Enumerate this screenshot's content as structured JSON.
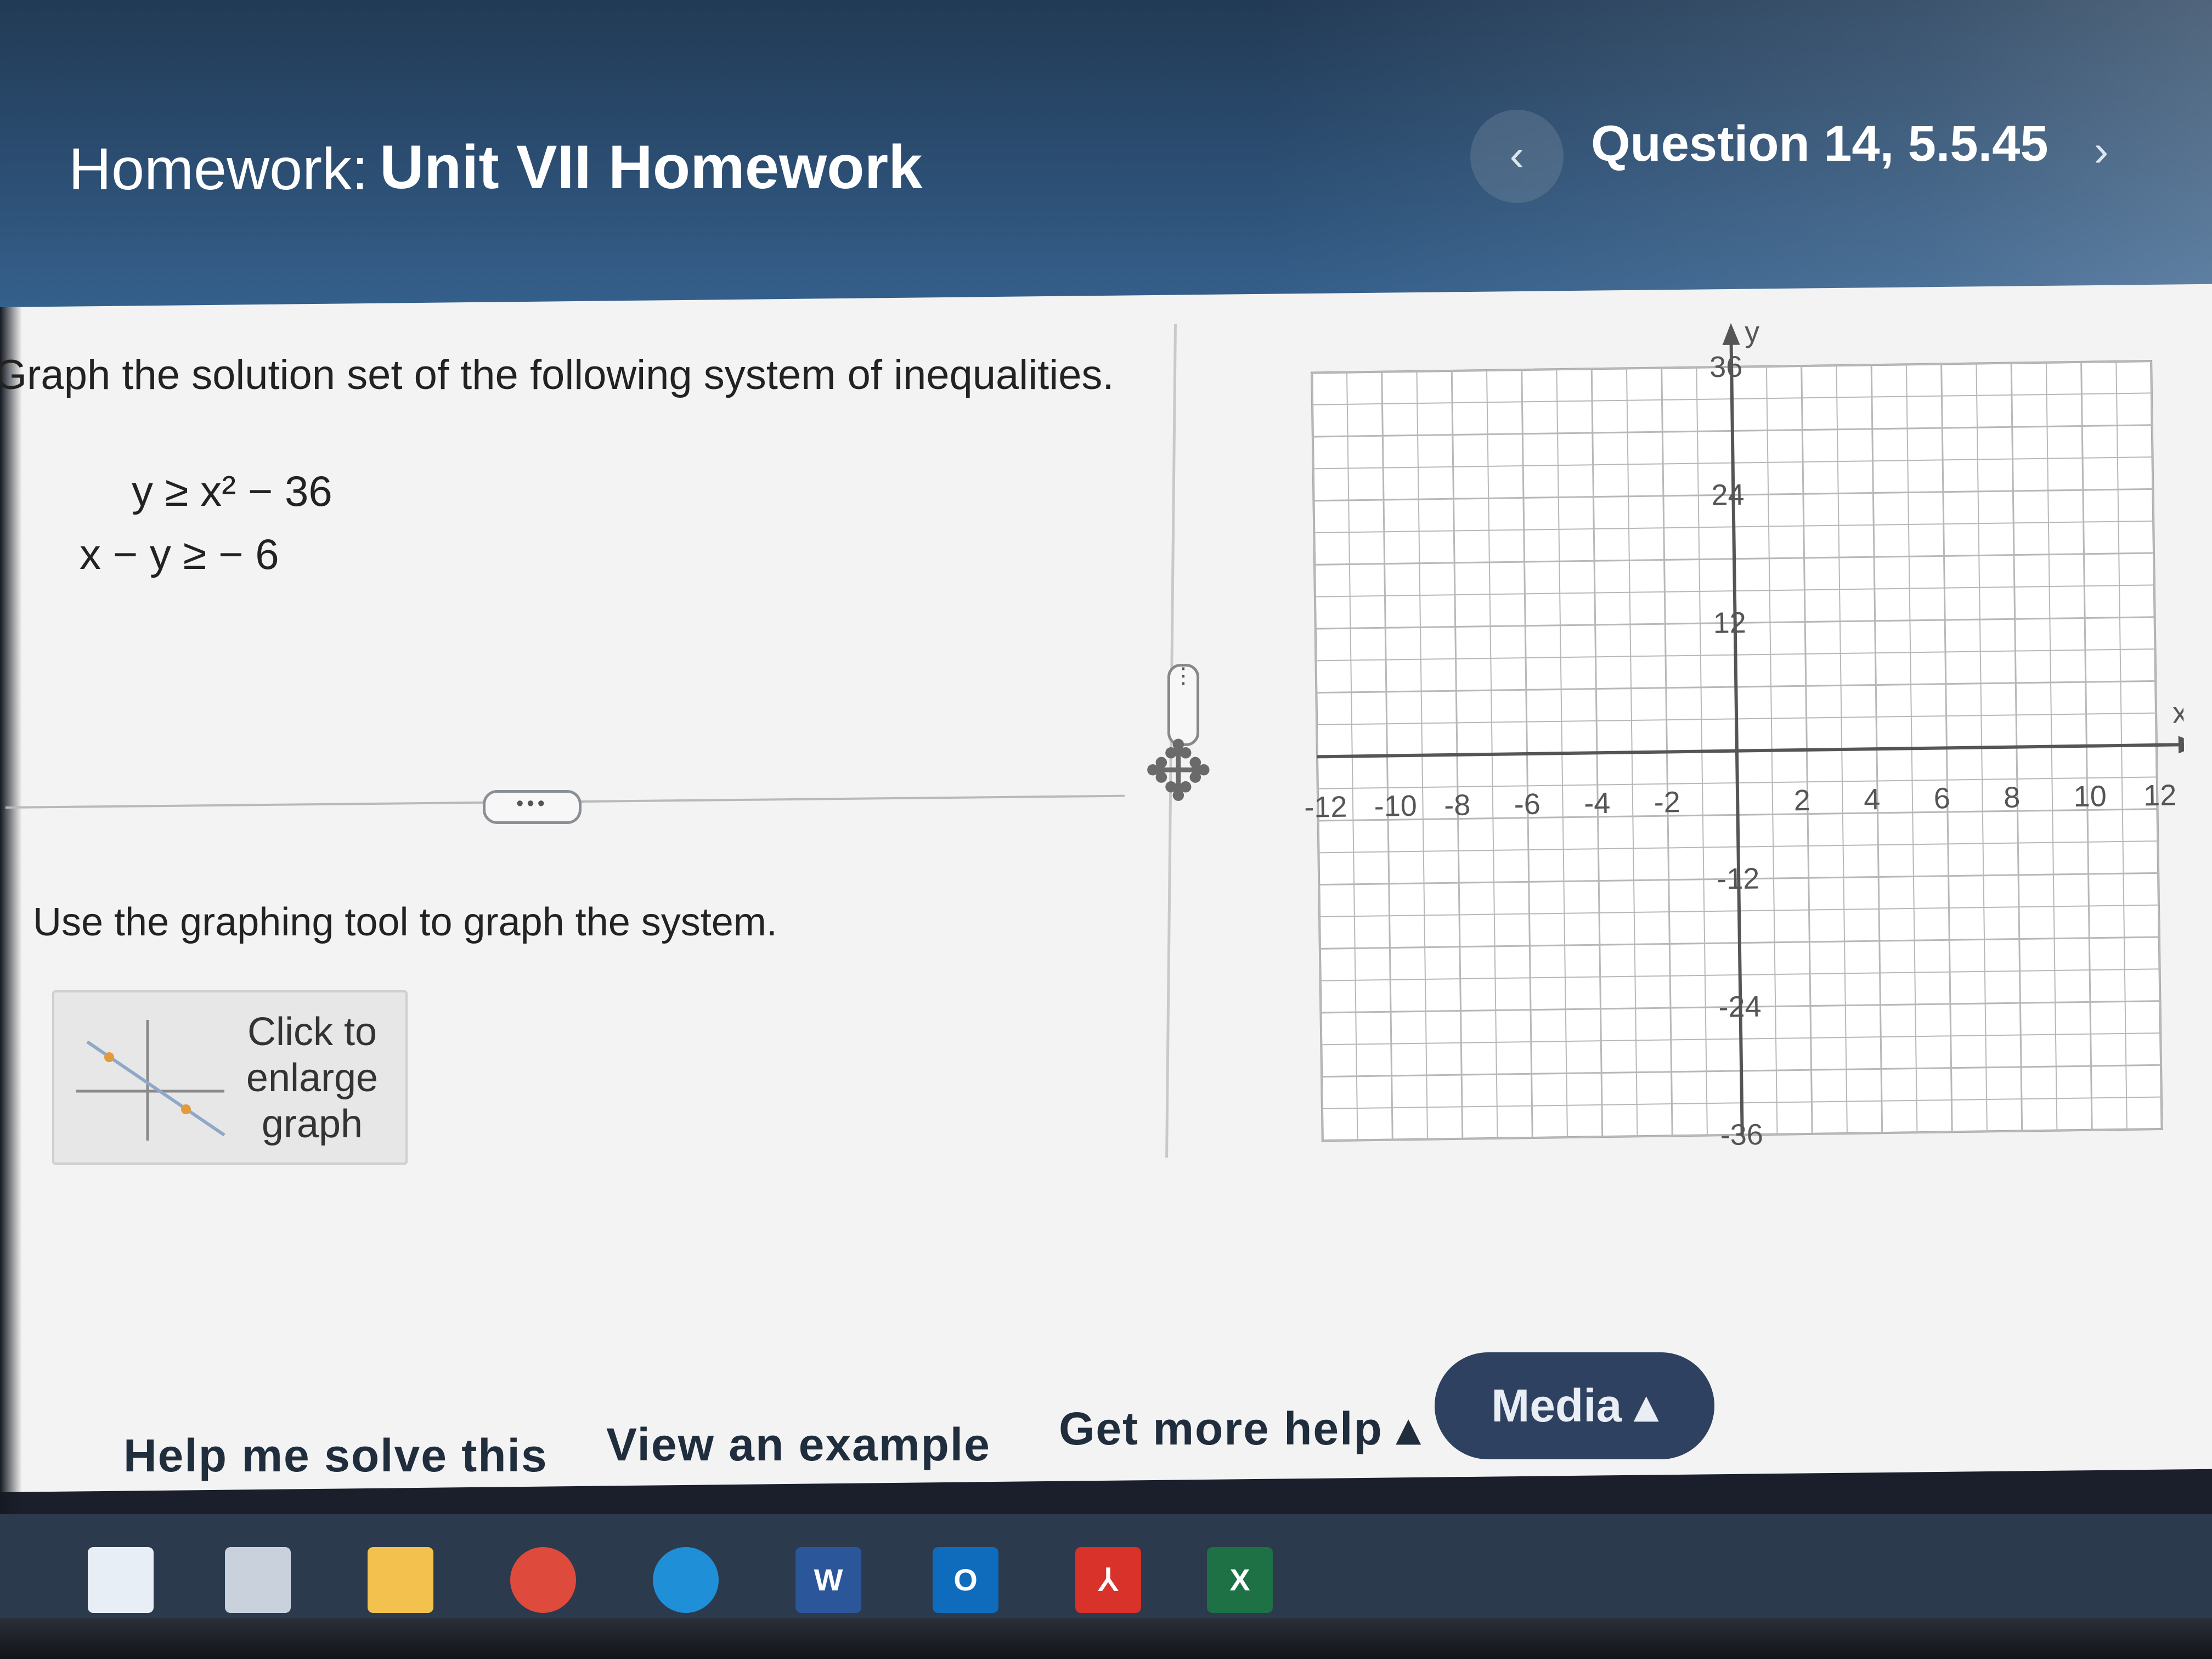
{
  "header": {
    "homework_label": "Homework:",
    "homework_title": "Unit VII Homework",
    "question_label": "Question 14, 5.5.45",
    "prev_symbol": "‹",
    "next_symbol": "›"
  },
  "problem": {
    "instruction": "Graph the solution set of the following system of inequalities.",
    "inequality_1": "y ≥ x² − 36",
    "inequality_2": "x − y ≥  − 6",
    "expand_label": "•••",
    "tool_instruction": "Use the graphing tool to graph the system.",
    "enlarge_label": "Click to\nenlarge\ngraph"
  },
  "graph": {
    "x_axis_label": "x",
    "y_axis_label": "y",
    "x_ticks": [
      "-12",
      "-10",
      "-8",
      "-6",
      "-4",
      "-2",
      "2",
      "4",
      "6",
      "8",
      "10",
      "12"
    ],
    "y_ticks": [
      "36",
      "24",
      "12",
      "-12",
      "-24",
      "-36"
    ],
    "x_range": [
      -12,
      12
    ],
    "y_range": [
      -36,
      36
    ]
  },
  "help": {
    "solve_label": "Help me solve this",
    "example_label": "View an example",
    "more_label": "Get more help ▴",
    "media_label": "Media ▴"
  },
  "taskbar": {
    "icons": [
      {
        "name": "windows-start-icon",
        "label": "",
        "color": "#e8eef5"
      },
      {
        "name": "task-view-icon",
        "label": "",
        "color": "#c9d2dc"
      },
      {
        "name": "file-explorer-icon",
        "label": "",
        "color": "#f2c14e"
      },
      {
        "name": "chrome-icon",
        "label": "",
        "color": "#de4b3c"
      },
      {
        "name": "edge-icon",
        "label": "",
        "color": "#1f8fd8"
      },
      {
        "name": "word-icon",
        "label": "W",
        "color": "#2b579a"
      },
      {
        "name": "outlook-icon",
        "label": "O",
        "color": "#0f6cbd"
      },
      {
        "name": "acrobat-icon",
        "label": "⅄",
        "color": "#d9322b"
      },
      {
        "name": "excel-icon",
        "label": "X",
        "color": "#1e7145"
      }
    ]
  },
  "colors": {
    "header_bg": "#2c4f74",
    "media_button": "#2e4160",
    "content_bg": "#f3f3f3"
  }
}
